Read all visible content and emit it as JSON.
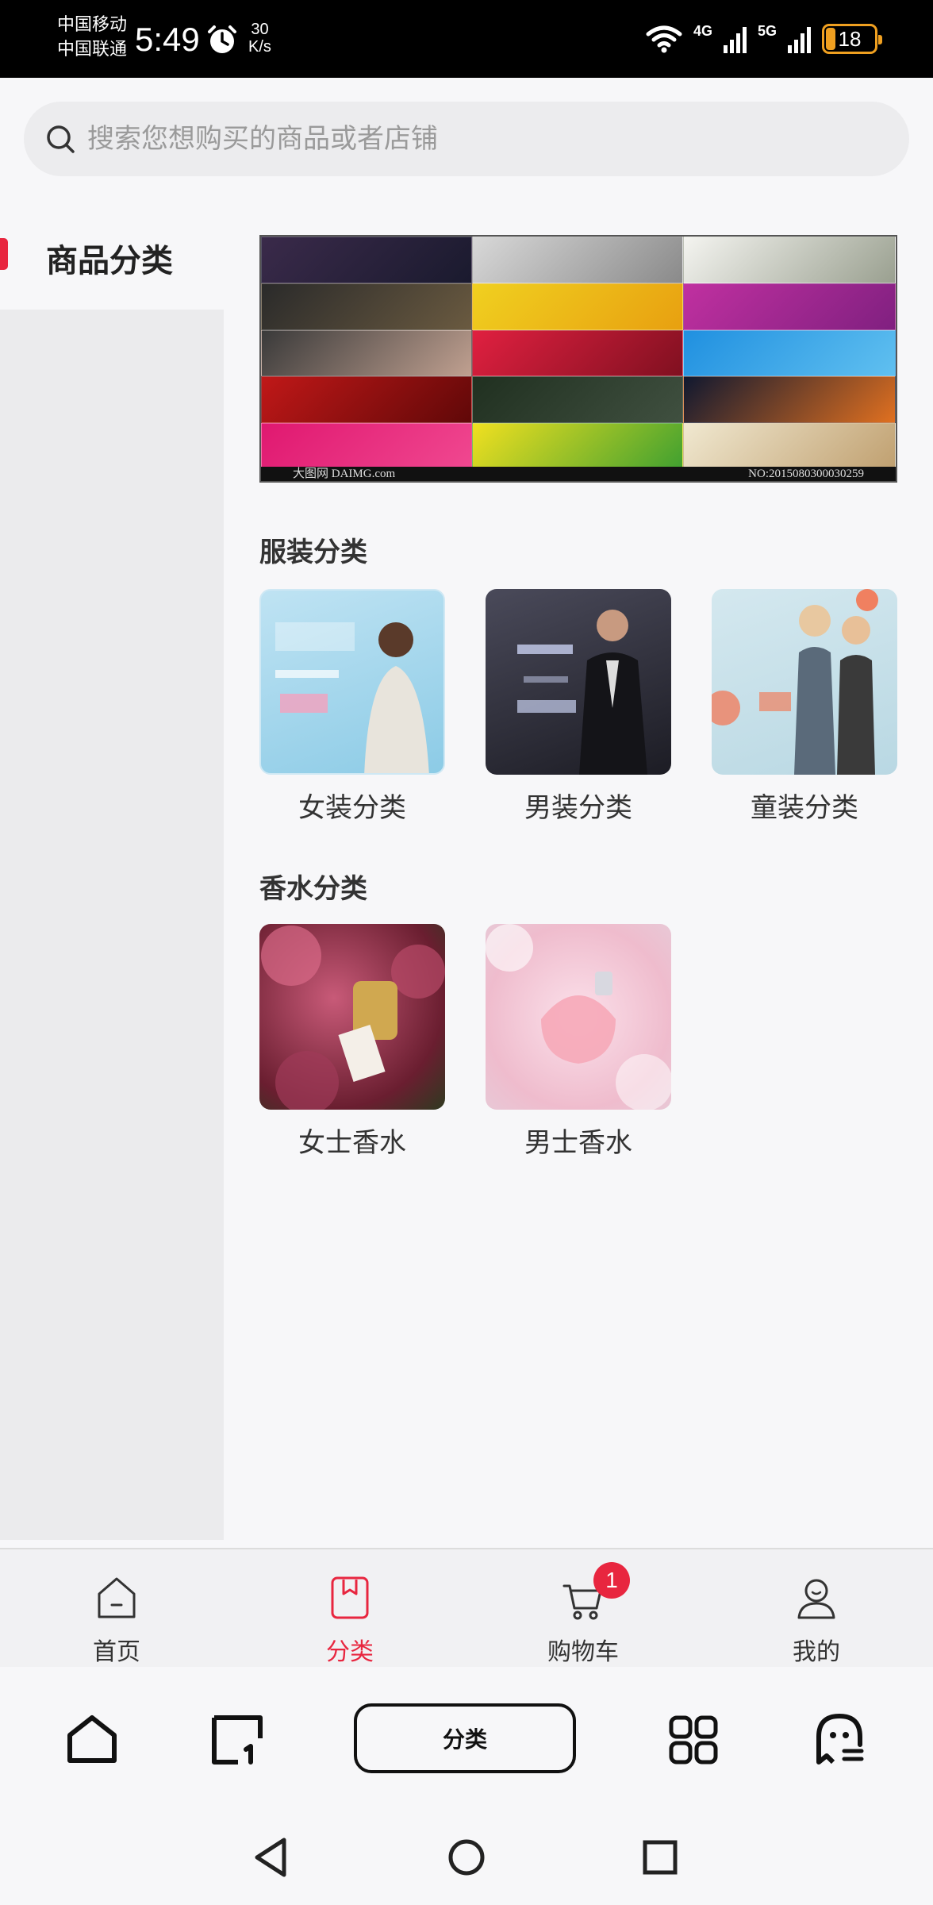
{
  "status_bar": {
    "carrier_1": "中国移动",
    "carrier_2": "中国联通",
    "time": "5:49",
    "speed_value": "30",
    "speed_unit": "K/s",
    "net_1": "4G",
    "net_2": "5G",
    "battery": "18"
  },
  "search": {
    "placeholder": "搜索您想购买的商品或者店铺"
  },
  "sidebar": {
    "items": [
      {
        "label": "商品分类",
        "active": true
      }
    ]
  },
  "banner": {
    "watermark_left": "大图网 DAIMG.com",
    "watermark_right": "NO:20150803000302​59"
  },
  "sections": [
    {
      "title": "服装分类",
      "items": [
        {
          "label": "女装分类",
          "image": "womens-clothing-banner"
        },
        {
          "label": "男装分类",
          "image": "mens-clothing-banner"
        },
        {
          "label": "童装分类",
          "image": "kids-clothing-banner"
        }
      ]
    },
    {
      "title": "香水分类",
      "items": [
        {
          "label": "女士香水",
          "image": "womens-perfume-photo"
        },
        {
          "label": "男士香水",
          "image": "mens-perfume-photo"
        }
      ]
    }
  ],
  "tabbar": {
    "tabs": [
      {
        "label": "首页",
        "icon": "home-icon",
        "active": false
      },
      {
        "label": "分类",
        "icon": "category-icon",
        "active": true
      },
      {
        "label": "购物车",
        "icon": "cart-icon",
        "active": false,
        "badge": "1"
      },
      {
        "label": "我的",
        "icon": "profile-icon",
        "active": false
      }
    ]
  },
  "phone_nav": {
    "pill_label": "分类"
  },
  "colors": {
    "accent": "#e8263f",
    "background": "#f7f7f9",
    "sidebar_inactive": "#ebebed"
  }
}
